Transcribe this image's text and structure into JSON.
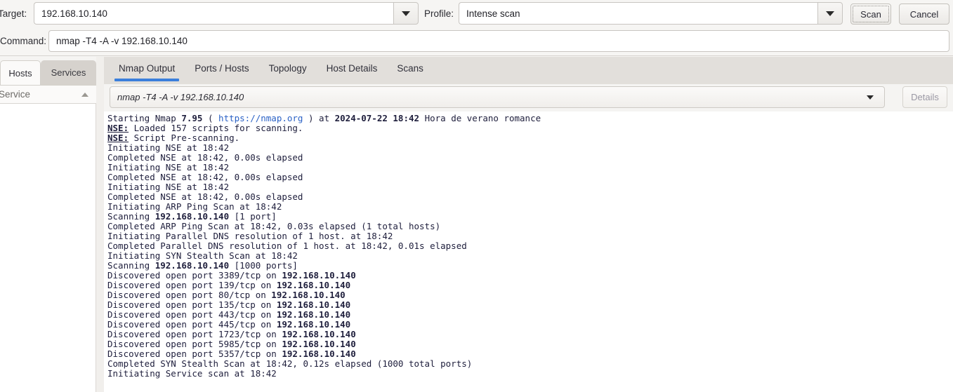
{
  "toolbar": {
    "target_label": "Target:",
    "target_value": "192.168.10.140",
    "profile_label": "Profile:",
    "profile_value": "Intense scan",
    "command_label": "Command:",
    "command_value": "nmap -T4 -A -v 192.168.10.140",
    "scan_label": "Scan",
    "cancel_label": "Cancel",
    "dropdown_icon": "chevron-down-icon"
  },
  "sidebar": {
    "tabs": [
      {
        "label": "Hosts",
        "active": true
      },
      {
        "label": "Services",
        "active": false
      }
    ],
    "column_header": "Service",
    "sort_icon": "sort-ascending-icon",
    "items": []
  },
  "main": {
    "tabs": [
      {
        "label": "Nmap Output",
        "active": true
      },
      {
        "label": "Ports / Hosts",
        "active": false
      },
      {
        "label": "Topology",
        "active": false
      },
      {
        "label": "Host Details",
        "active": false
      },
      {
        "label": "Scans",
        "active": false
      }
    ],
    "active_tab_accent": "#3b7fdc",
    "scan_selector_value": "nmap -T4 -A -v 192.168.10.140",
    "scan_selector_icon": "chevron-down-icon",
    "details_label": "Details",
    "details_disabled": true
  },
  "output": {
    "text_color": "#1e1e3c",
    "link_color": "#2b62c6",
    "lines": [
      [
        {
          "t": "Starting Nmap ",
          "s": ""
        },
        {
          "t": "7.95",
          "s": "b"
        },
        {
          "t": " ( ",
          "s": ""
        },
        {
          "t": "https://nmap.org",
          "s": "lnk"
        },
        {
          "t": " ) at ",
          "s": ""
        },
        {
          "t": "2024-07-22 18:42",
          "s": "b"
        },
        {
          "t": " Hora de verano romance",
          "s": ""
        }
      ],
      [
        {
          "t": "NSE:",
          "s": "nse"
        },
        {
          "t": " Loaded 157 scripts for scanning.",
          "s": ""
        }
      ],
      [
        {
          "t": "NSE:",
          "s": "nse"
        },
        {
          "t": " Script Pre-scanning.",
          "s": ""
        }
      ],
      [
        {
          "t": "Initiating NSE at 18:42",
          "s": ""
        }
      ],
      [
        {
          "t": "Completed NSE at 18:42, 0.00s elapsed",
          "s": ""
        }
      ],
      [
        {
          "t": "Initiating NSE at 18:42",
          "s": ""
        }
      ],
      [
        {
          "t": "Completed NSE at 18:42, 0.00s elapsed",
          "s": ""
        }
      ],
      [
        {
          "t": "Initiating NSE at 18:42",
          "s": ""
        }
      ],
      [
        {
          "t": "Completed NSE at 18:42, 0.00s elapsed",
          "s": ""
        }
      ],
      [
        {
          "t": "Initiating ARP Ping Scan at 18:42",
          "s": ""
        }
      ],
      [
        {
          "t": "Scanning ",
          "s": ""
        },
        {
          "t": "192.168.10.140",
          "s": "b"
        },
        {
          "t": " [1 port]",
          "s": ""
        }
      ],
      [
        {
          "t": "Completed ARP Ping Scan at 18:42, 0.03s elapsed (1 total hosts)",
          "s": ""
        }
      ],
      [
        {
          "t": "Initiating Parallel DNS resolution of 1 host. at 18:42",
          "s": ""
        }
      ],
      [
        {
          "t": "Completed Parallel DNS resolution of 1 host. at 18:42, 0.01s elapsed",
          "s": ""
        }
      ],
      [
        {
          "t": "Initiating SYN Stealth Scan at 18:42",
          "s": ""
        }
      ],
      [
        {
          "t": "Scanning ",
          "s": ""
        },
        {
          "t": "192.168.10.140",
          "s": "b"
        },
        {
          "t": " [1000 ports]",
          "s": ""
        }
      ],
      [
        {
          "t": "Discovered open port 3389/tcp on ",
          "s": ""
        },
        {
          "t": "192.168.10.140",
          "s": "b"
        }
      ],
      [
        {
          "t": "Discovered open port 139/tcp on ",
          "s": ""
        },
        {
          "t": "192.168.10.140",
          "s": "b"
        }
      ],
      [
        {
          "t": "Discovered open port 80/tcp on ",
          "s": ""
        },
        {
          "t": "192.168.10.140",
          "s": "b"
        }
      ],
      [
        {
          "t": "Discovered open port 135/tcp on ",
          "s": ""
        },
        {
          "t": "192.168.10.140",
          "s": "b"
        }
      ],
      [
        {
          "t": "Discovered open port 443/tcp on ",
          "s": ""
        },
        {
          "t": "192.168.10.140",
          "s": "b"
        }
      ],
      [
        {
          "t": "Discovered open port 445/tcp on ",
          "s": ""
        },
        {
          "t": "192.168.10.140",
          "s": "b"
        }
      ],
      [
        {
          "t": "Discovered open port 1723/tcp on ",
          "s": ""
        },
        {
          "t": "192.168.10.140",
          "s": "b"
        }
      ],
      [
        {
          "t": "Discovered open port 5985/tcp on ",
          "s": ""
        },
        {
          "t": "192.168.10.140",
          "s": "b"
        }
      ],
      [
        {
          "t": "Discovered open port 5357/tcp on ",
          "s": ""
        },
        {
          "t": "192.168.10.140",
          "s": "b"
        }
      ],
      [
        {
          "t": "Completed SYN Stealth Scan at 18:42, 0.12s elapsed (1000 total ports)",
          "s": ""
        }
      ],
      [
        {
          "t": "Initiating Service scan at 18:42",
          "s": ""
        }
      ]
    ]
  }
}
